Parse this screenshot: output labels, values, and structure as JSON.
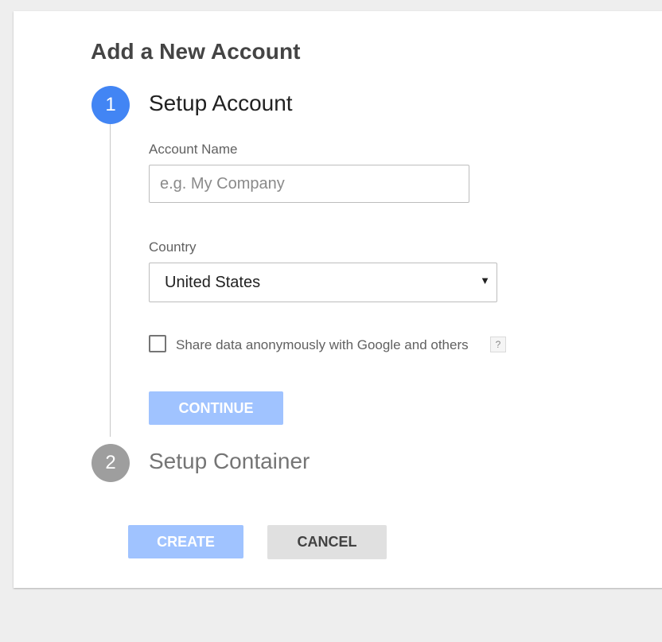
{
  "page": {
    "title": "Add a New Account"
  },
  "steps": [
    {
      "number": "1",
      "title": "Setup Account",
      "color": "#4285f4"
    },
    {
      "number": "2",
      "title": "Setup Container",
      "color": "#9e9e9e"
    }
  ],
  "account_form": {
    "account_name_label": "Account Name",
    "account_name_placeholder": "e.g. My Company",
    "account_name_value": "",
    "country_label": "Country",
    "country_selected": "United States",
    "share_data_label": "Share data anonymously with Google and others",
    "share_data_checked": false,
    "help_icon": "help-icon",
    "help_symbol": "?",
    "select_arrow": "▼",
    "continue_label": "CONTINUE"
  },
  "footer": {
    "create_label": "CREATE",
    "cancel_label": "CANCEL"
  },
  "colors": {
    "primary": "#4285f4",
    "primary_disabled": "#a0c3ff",
    "inactive_step": "#9e9e9e"
  }
}
